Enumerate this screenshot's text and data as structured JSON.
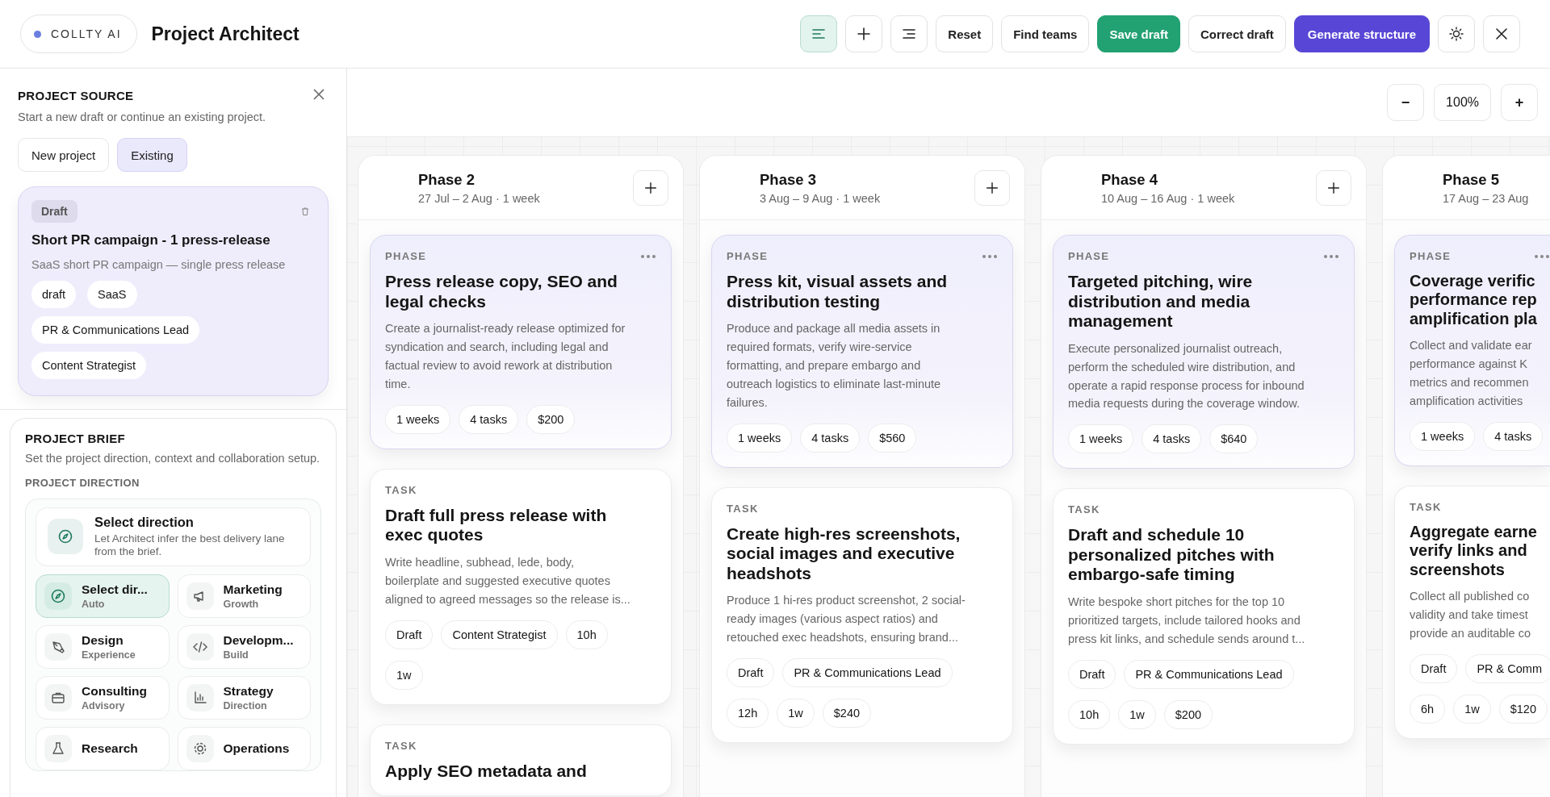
{
  "brand": {
    "name": "COLLTY AI"
  },
  "title": "Project Architect",
  "toolbar": [
    {
      "kind": "icon",
      "selected": true
    },
    {
      "kind": "icon",
      "selected": false
    },
    {
      "kind": "icon",
      "selected": false
    },
    {
      "kind": "plain",
      "label": "Reset"
    },
    {
      "kind": "plain",
      "label": "Find teams"
    },
    {
      "kind": "success",
      "label": "Save draft"
    },
    {
      "kind": "plain",
      "label": "Correct draft"
    },
    {
      "kind": "primary",
      "label": "Generate structure"
    },
    {
      "kind": "icon",
      "selected": false
    },
    {
      "kind": "icon",
      "selected": false
    }
  ],
  "source": {
    "heading": "PROJECT SOURCE",
    "subtitle": "Start a new draft or continue an existing project.",
    "modes": [
      {
        "label": "New project",
        "selected": false
      },
      {
        "label": "Existing",
        "selected": true
      }
    ],
    "project": {
      "status": "Draft",
      "name": "Short PR campaign - 1 press-release",
      "description": "SaaS short PR campaign — single press release",
      "tags": [
        "draft",
        "SaaS",
        "PR & Communications Lead",
        "Content Strategist"
      ]
    }
  },
  "brief": {
    "heading": "PROJECT BRIEF",
    "subtitle": "Set the project direction, context and collaboration setup.",
    "direction_label": "PROJECT DIRECTION",
    "current": {
      "title": "Select direction",
      "hint": "Let Architect infer the best delivery lane from the brief."
    },
    "directions": [
      {
        "title": "Select dir...",
        "sub": "Auto",
        "selected": true
      },
      {
        "title": "Marketing",
        "sub": "Growth",
        "selected": false
      },
      {
        "title": "Design",
        "sub": "Experience",
        "selected": false
      },
      {
        "title": "Developm...",
        "sub": "Build",
        "selected": false
      },
      {
        "title": "Consulting",
        "sub": "Advisory",
        "selected": false
      },
      {
        "title": "Strategy",
        "sub": "Direction",
        "selected": false
      },
      {
        "title": "Research",
        "selected": false
      },
      {
        "title": "Operations",
        "selected": false
      }
    ]
  },
  "zoom": {
    "out": "−",
    "level": "100%",
    "in": "+"
  },
  "columns": [
    {
      "title": "Phase 2",
      "dates": "27 Jul – 2 Aug · 1 week",
      "cards": [
        {
          "kind": "phase",
          "label": "PHASE",
          "title": "Press release copy, SEO and\nlegal checks",
          "description": "Create a journalist-ready release optimized for\nsyndication and search, including legal and\nfactual review to avoid rework at distribution\ntime.",
          "chips": [
            [
              "1 weeks",
              "4 tasks",
              "$200"
            ]
          ]
        },
        {
          "kind": "task",
          "label": "TASK",
          "title": "Draft full press release with\nexec quotes",
          "description": "Write headline, subhead, lede, body,\nboilerplate and suggested executive quotes\naligned to agreed messages so the release is...",
          "chips": [
            [
              "Draft",
              "Content Strategist",
              "10h"
            ],
            [
              "1w"
            ]
          ]
        },
        {
          "kind": "task",
          "label": "TASK",
          "title": "Apply SEO metadata and"
        }
      ]
    },
    {
      "title": "Phase 3",
      "dates": "3 Aug – 9 Aug · 1 week",
      "cards": [
        {
          "kind": "phase",
          "label": "PHASE",
          "title": "Press kit, visual assets and\ndistribution testing",
          "description": "Produce and package all media assets in\nrequired formats, verify wire-service\nformatting, and prepare embargo and\noutreach logistics to eliminate last-minute\nfailures.",
          "chips": [
            [
              "1 weeks",
              "4 tasks",
              "$560"
            ]
          ]
        },
        {
          "kind": "task",
          "label": "TASK",
          "title": "Create high-res screenshots,\nsocial images and executive\nheadshots",
          "description": "Produce 1 hi-res product screenshot, 2 social-\nready images (various aspect ratios) and\nretouched exec headshots, ensuring brand...",
          "chips": [
            [
              "Draft",
              "PR & Communications Lead"
            ],
            [
              "12h",
              "1w",
              "$240"
            ]
          ]
        }
      ]
    },
    {
      "title": "Phase 4",
      "dates": "10 Aug – 16 Aug · 1 week",
      "cards": [
        {
          "kind": "phase",
          "label": "PHASE",
          "title": "Targeted pitching, wire\ndistribution and media\nmanagement",
          "description": "Execute personalized journalist outreach,\nperform the scheduled wire distribution, and\noperate a rapid response process for inbound\nmedia requests during the coverage window.",
          "chips": [
            [
              "1 weeks",
              "4 tasks",
              "$640"
            ]
          ]
        },
        {
          "kind": "task",
          "label": "TASK",
          "title": "Draft and schedule 10\npersonalized pitches with\nembargo-safe timing",
          "description": "Write bespoke short pitches for the top 10\nprioritized targets, include tailored hooks and\npress kit links, and schedule sends around t...",
          "chips": [
            [
              "Draft",
              "PR & Communications Lead"
            ],
            [
              "10h",
              "1w",
              "$200"
            ]
          ]
        }
      ]
    },
    {
      "title": "Phase 5",
      "dates": "17 Aug – 23 Aug",
      "cards": [
        {
          "kind": "phase",
          "label": "PHASE",
          "title": "Coverage verific\nperformance rep\namplification pla",
          "description": "Collect and validate ear\nperformance against K\nmetrics and recommen\namplification activities",
          "chips": [
            [
              "1 weeks",
              "4 tasks"
            ]
          ]
        },
        {
          "kind": "task",
          "label": "TASK",
          "title": "Aggregate earne\nverify links and\nscreenshots",
          "description": "Collect all published co\nvalidity and take timest\nprovide an auditable co",
          "chips": [
            [
              "Draft",
              "PR & Comm"
            ],
            [
              "6h",
              "1w",
              "$120"
            ]
          ]
        }
      ]
    }
  ]
}
